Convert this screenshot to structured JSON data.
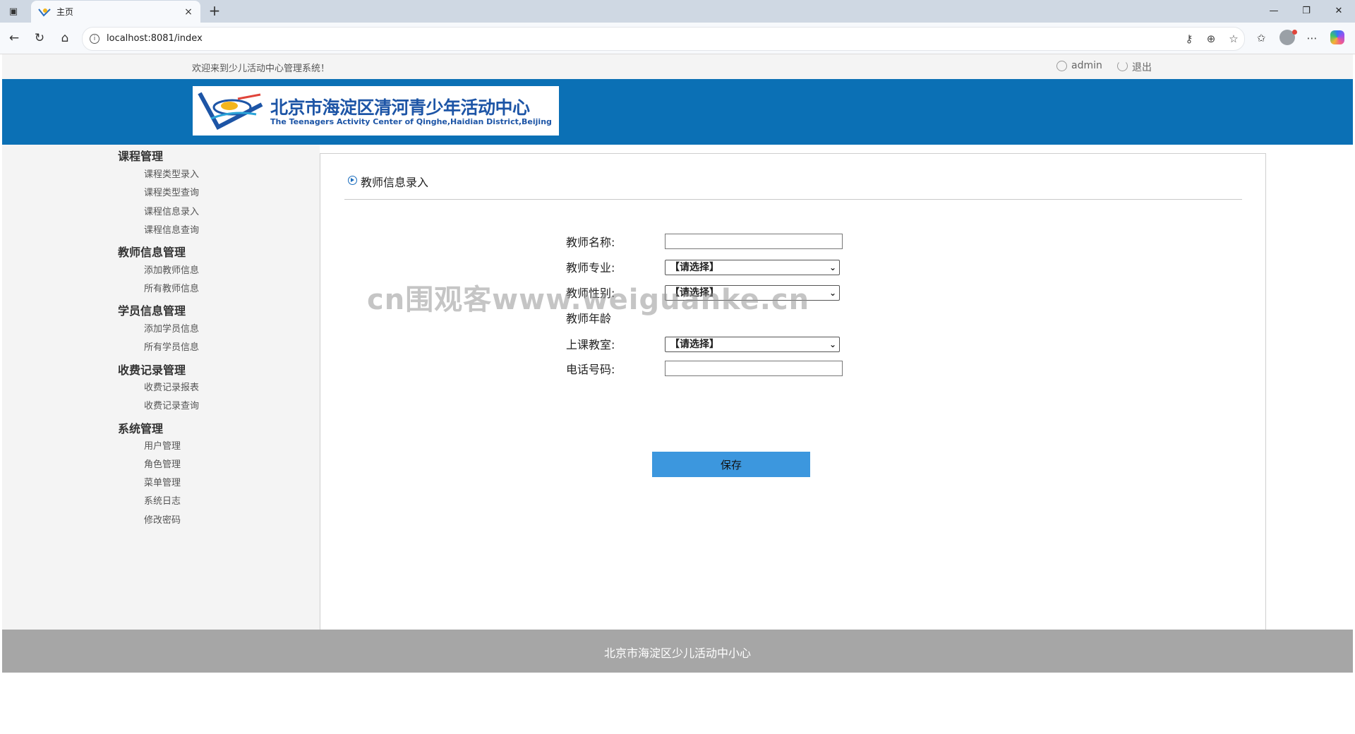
{
  "browser": {
    "tab_title": "主页",
    "url": "localhost:8081/index",
    "new_tab": "+",
    "close_tab": "×"
  },
  "header": {
    "welcome": "欢迎来到少儿活动中心管理系统！",
    "username": "admin",
    "logout": "退出"
  },
  "logo": {
    "title": "北京市海淀区清河青少年活动中心",
    "subtitle": "The Teenagers Activity Center of Qinghe,Haidian District,Beijing"
  },
  "sidebar": {
    "groups": [
      {
        "title": "课程管理",
        "items": [
          "课程类型录入",
          "课程类型查询",
          "课程信息录入",
          "课程信息查询"
        ]
      },
      {
        "title": "教师信息管理",
        "items": [
          "添加教师信息",
          "所有教师信息"
        ]
      },
      {
        "title": "学员信息管理",
        "items": [
          "添加学员信息",
          "所有学员信息"
        ]
      },
      {
        "title": "收费记录管理",
        "items": [
          "收费记录报表",
          "收费记录查询"
        ]
      },
      {
        "title": "系统管理",
        "items": [
          "用户管理",
          "角色管理",
          "菜单管理",
          "系统日志",
          "修改密码"
        ]
      }
    ]
  },
  "content": {
    "title": "教师信息录入",
    "form": {
      "name_label": "教师名称:",
      "name_value": "",
      "major_label": "教师专业:",
      "major_value": "【请选择】",
      "gender_label": "教师性别:",
      "gender_value": "【请选择】",
      "age_label": "教师年龄",
      "classroom_label": "上课教室:",
      "classroom_value": "【请选择】",
      "phone_label": "电话号码:",
      "phone_value": ""
    },
    "save_button": "保存"
  },
  "watermark": "cn围观客www.weiguanke.cn",
  "footer": {
    "text": "北京市海淀区少儿活动中小心"
  }
}
